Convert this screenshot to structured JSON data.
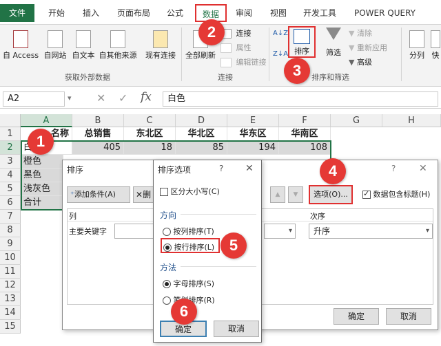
{
  "ribbon": {
    "tabs": [
      "文件",
      "开始",
      "插入",
      "页面布局",
      "公式",
      "数据",
      "审阅",
      "视图",
      "开发工具",
      "POWER QUERY"
    ],
    "external_data_group": {
      "buttons": [
        "自 Access",
        "自网站",
        "自文本",
        "自其他来源",
        "现有连接"
      ],
      "label": "获取外部数据"
    },
    "connections_group": {
      "refresh_all": "全部刷新",
      "connections": "连接",
      "properties": "属性",
      "edit_links": "编辑链接",
      "label": "连接"
    },
    "sort_filter_group": {
      "sort_az_glyph": "A↓Z",
      "sort_za_glyph": "Z↓A",
      "sort": "排序",
      "filter": "筛选",
      "clear": "清除",
      "reapply": "重新应用",
      "advanced": "高级",
      "label": "排序和筛选"
    },
    "data_tools": [
      "分列",
      "快"
    ]
  },
  "formula_bar": {
    "name_box": "A2",
    "cancel_glyph": "✕",
    "enter_glyph": "✓",
    "fx_glyph": "fx",
    "value": "白色"
  },
  "sheet": {
    "columns": [
      "A",
      "B",
      "C",
      "D",
      "E",
      "F",
      "G",
      "H"
    ],
    "rows": [
      "1",
      "2",
      "3",
      "4",
      "5",
      "6",
      "7",
      "8",
      "9",
      "10",
      "11",
      "12",
      "13",
      "14",
      "15"
    ],
    "header_row": [
      "名称",
      "总销售",
      "东北区",
      "华北区",
      "华东区",
      "华南区"
    ],
    "row2": [
      "白色",
      "405",
      "18",
      "85",
      "194",
      "108"
    ],
    "col_a": [
      "橙色",
      "黑色",
      "浅灰色",
      "合计"
    ]
  },
  "sort_dialog": {
    "title": "排序",
    "help": "?",
    "close": "✕",
    "add_condition": "添加条件(A)",
    "delete_condition": "删",
    "move_up": "▲",
    "move_down": "▼",
    "options_button": "选项(O)...",
    "has_headers_label": "数据包含标题(H)",
    "col_header": "列",
    "order_header": "次序",
    "primary_key_label": "主要关键字",
    "order_value": "升序",
    "ok": "确定",
    "cancel": "取消"
  },
  "sort_options_dialog": {
    "title": "排序选项",
    "help": "?",
    "close": "✕",
    "case_sensitive": "区分大小写(C)",
    "direction_label": "方向",
    "by_column": "按列排序(T)",
    "by_row": "按行排序(L)",
    "method_label": "方法",
    "by_letter": "字母排序(S)",
    "by_stroke": "笔划排序(R)",
    "ok": "确定",
    "cancel": "取消"
  },
  "step_markers": [
    "1",
    "2",
    "3",
    "4",
    "5",
    "6"
  ],
  "colors": {
    "accent": "#217346",
    "marker": "#e53935"
  }
}
